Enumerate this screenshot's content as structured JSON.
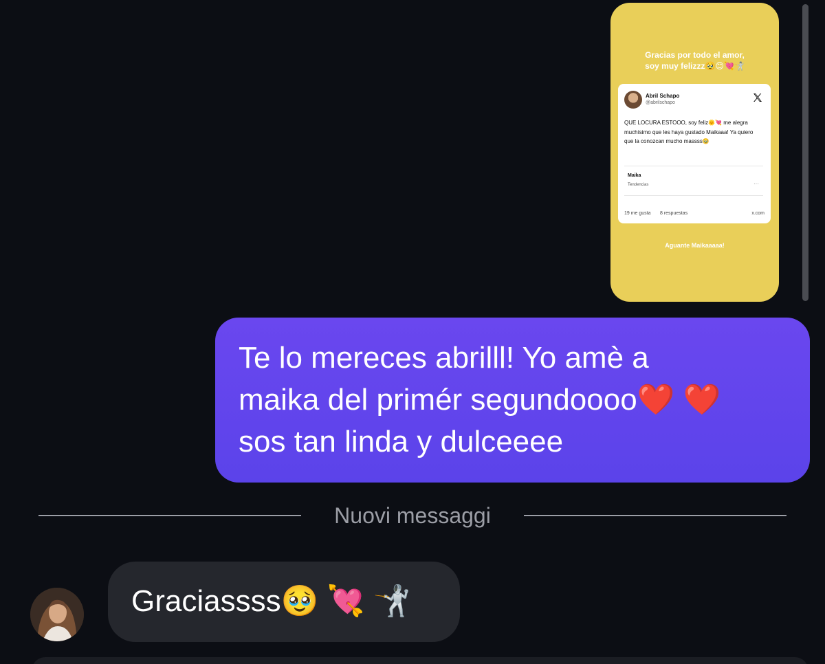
{
  "colors": {
    "background": "#0c0e14",
    "outgoing_bubble": "#5b43ea",
    "incoming_bubble": "#25272d",
    "story_background": "#e9cf59",
    "divider": "#9c9ea6"
  },
  "story": {
    "caption_line1": "Gracias por todo el amor,",
    "caption_line2": "soy muy felizzz🥹😊💘🤺",
    "tweet": {
      "name": "Abril Schapo",
      "handle": "@abrilschapo",
      "platform_icon": "x-logo-icon",
      "text": "QUE LOCURA ESTOOO, soy feliz🌞💘 me alegra muchísimo que les haya gustado Maikaaa! Ya quiero que la conozcan mucho massss🥹",
      "trend_title": "Maika",
      "trend_subtitle": "Tendencias",
      "trend_more": "···",
      "likes": "19 me gusta",
      "replies": "8 respuestas",
      "domain": "x.com"
    },
    "footer": "Aguante Maikaaaaa!"
  },
  "outgoing": {
    "line1": "Te lo mereces abrilll! Yo amè a",
    "line2_text": "maika del primér segundoooo",
    "line2_emoji": "❤️ ❤️",
    "line3": "sos tan linda y dulceeee"
  },
  "divider": {
    "label": "Nuovi messaggi"
  },
  "incoming": {
    "text": "Graciassss🥹 💘 🤺",
    "avatar_icon": "contact-avatar"
  }
}
